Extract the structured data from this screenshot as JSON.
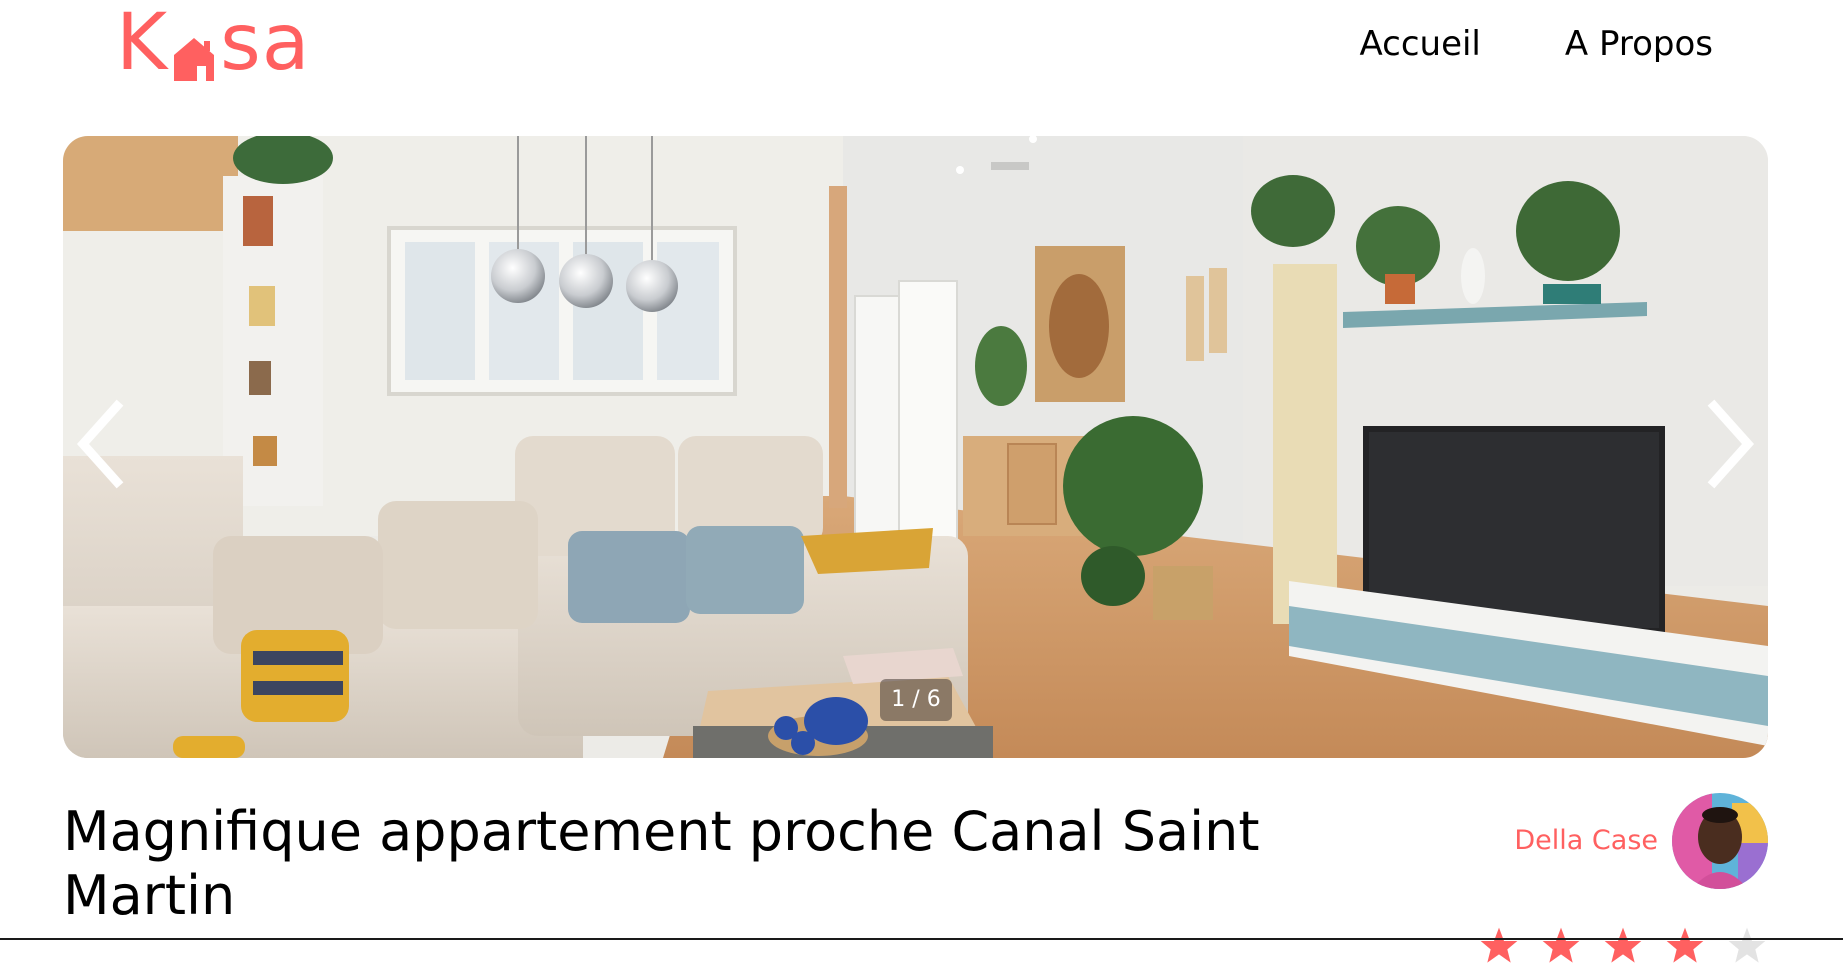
{
  "brand": {
    "logo_letters": [
      "K",
      "sa"
    ],
    "color": "#ff6060"
  },
  "nav": {
    "items": [
      "Accueil",
      "A Propos"
    ]
  },
  "gallery": {
    "counter": "1 / 6",
    "prev_icon": "chevron-left-icon",
    "next_icon": "chevron-right-icon"
  },
  "listing": {
    "title": "Magnifique appartement proche Canal Saint Martin"
  },
  "host": {
    "name": "Della Case"
  },
  "rating": {
    "value": 4,
    "max": 5,
    "active_color": "#ff6060",
    "inactive_color": "#e3e3e3"
  }
}
